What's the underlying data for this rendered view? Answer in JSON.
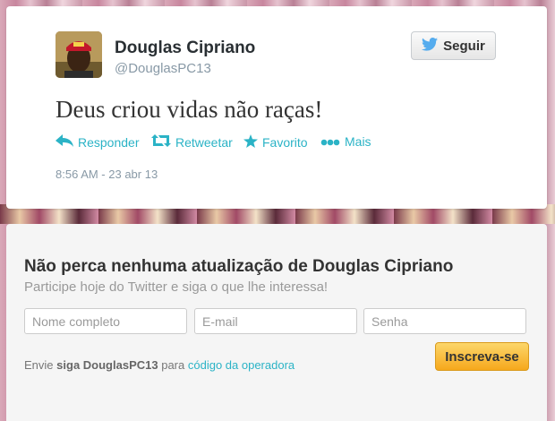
{
  "tweet": {
    "author_name": "Douglas Cipriano",
    "author_handle": "@DouglasPC13",
    "follow_label": "Seguir",
    "text": "Deus criou vidas não raças!",
    "actions": {
      "reply": "Responder",
      "retweet": "Retweetar",
      "favorite": "Favorito",
      "more": "Mais"
    },
    "timestamp": "8:56 AM - 23 abr 13"
  },
  "signup": {
    "title": "Não perca nenhuma atualização de Douglas Cipriano",
    "subtitle": "Participe hoje do Twitter e siga o que lhe interessa!",
    "fields": {
      "name_placeholder": "Nome completo",
      "email_placeholder": "E-mail",
      "password_placeholder": "Senha"
    },
    "button_label": "Inscreva-se",
    "sms": {
      "prefix": "Envie",
      "command": "siga DouglasPC13",
      "middle": "para",
      "link": "código da operadora"
    }
  },
  "colors": {
    "link": "#2bb3c6",
    "twitter_bird": "#55acee",
    "signup_button": "#f6a81c"
  },
  "icons": [
    "twitter-bird-icon",
    "reply-icon",
    "retweet-icon",
    "star-icon",
    "more-dots-icon"
  ]
}
